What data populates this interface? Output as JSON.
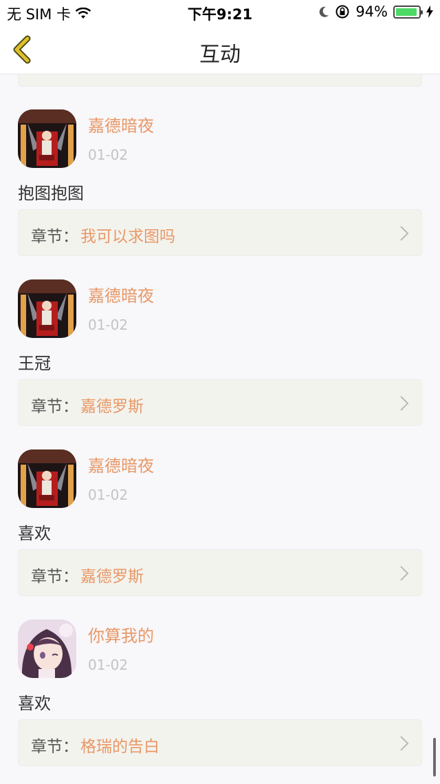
{
  "status_bar": {
    "carrier": "无 SIM 卡",
    "time": "下午9:21",
    "battery_percent": "94%",
    "battery_level": 0.94
  },
  "nav": {
    "title": "互动",
    "back_icon": "chevron-left-icon"
  },
  "chapter_label": "章节：",
  "items": [
    {
      "username": "嘉德暗夜",
      "date": "01-02",
      "comment": "抱图抱图",
      "chapter": "我可以求图吗",
      "avatar": "throne-avatar"
    },
    {
      "username": "嘉德暗夜",
      "date": "01-02",
      "comment": "王冠",
      "chapter": "嘉德罗斯",
      "avatar": "throne-avatar"
    },
    {
      "username": "嘉德暗夜",
      "date": "01-02",
      "comment": "喜欢",
      "chapter": "嘉德罗斯",
      "avatar": "throne-avatar"
    },
    {
      "username": "你算我的",
      "date": "01-02",
      "comment": "喜欢",
      "chapter": "格瑞的告白",
      "avatar": "girl-avatar"
    }
  ],
  "colors": {
    "accent": "#e89866",
    "card": "#f3f3ee",
    "date": "#c3c3c3",
    "back_arrow": "#e0c02a"
  }
}
